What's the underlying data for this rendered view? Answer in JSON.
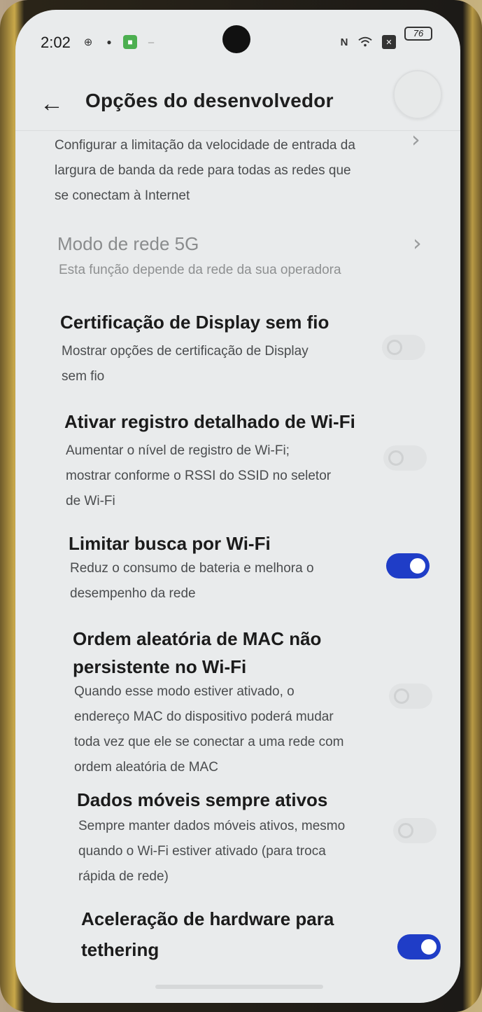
{
  "status_bar": {
    "time": "2:02",
    "battery": "76"
  },
  "header": {
    "title": "Opções do desenvolvedor"
  },
  "items": [
    {
      "desc": "Configurar a limitação da velocidade de entrada da largura de banda da rede para todas as redes que se conectam à Internet",
      "desc_lines": [
        "Configurar a limitação da velocidade de entrada da",
        "largura de banda da rede para todas as redes que",
        "se conectam à Internet"
      ]
    },
    {
      "title": "Modo de rede 5G",
      "desc": "Esta função depende da rede da sua operadora"
    },
    {
      "title": "Certificação de Display sem fio",
      "desc_lines": [
        "Mostrar opções de certificação de Display",
        "sem fio"
      ],
      "enabled": false
    },
    {
      "title": "Ativar registro detalhado de Wi-Fi",
      "desc_lines": [
        "Aumentar o nível de registro de Wi-Fi;",
        "mostrar conforme o RSSI do SSID no seletor",
        "de Wi-Fi"
      ],
      "enabled": false
    },
    {
      "title": "Limitar busca por Wi-Fi",
      "desc_lines": [
        "Reduz o consumo de bateria e melhora o",
        "desempenho da rede"
      ],
      "enabled": true
    },
    {
      "title_lines": [
        "Ordem aleatória de MAC não",
        "persistente no Wi-Fi"
      ],
      "desc_lines": [
        "Quando esse modo estiver ativado, o",
        "endereço MAC do dispositivo poderá mudar",
        "toda vez que ele se conectar a uma rede com",
        "ordem aleatória de MAC"
      ],
      "enabled": false
    },
    {
      "title": "Dados móveis sempre ativos",
      "desc_lines": [
        "Sempre manter dados móveis ativos, mesmo",
        "quando o Wi-Fi estiver ativado (para troca",
        "rápida de rede)"
      ],
      "enabled": false
    },
    {
      "title_lines": [
        "Aceleração de hardware para",
        "tethering"
      ],
      "enabled": true
    }
  ],
  "colors": {
    "accent": "#1f3dc7",
    "background": "#e9ebec"
  }
}
